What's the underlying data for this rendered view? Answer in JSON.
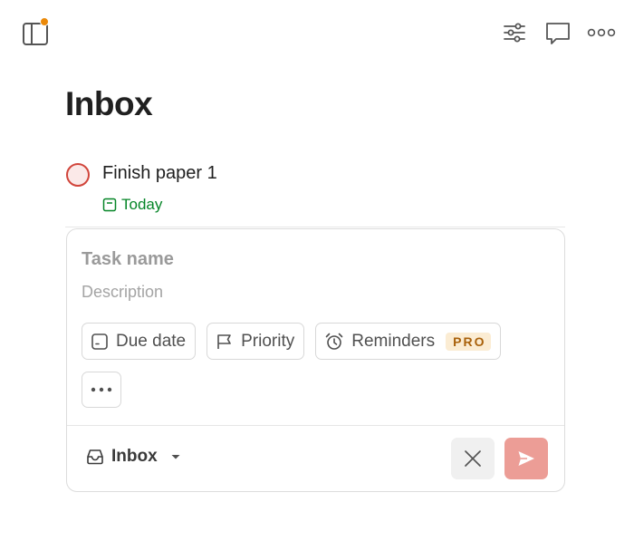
{
  "header": {
    "icons": [
      "sidebar-toggle-icon",
      "view-options-icon",
      "comments-icon",
      "more-horizontal-icon"
    ],
    "notification_dot_color": "#eb8909"
  },
  "page": {
    "title": "Inbox"
  },
  "task": {
    "title": "Finish paper 1",
    "due_label": "Today",
    "priority_color": "#d1453b",
    "due_color": "#058527"
  },
  "editor": {
    "task_name_placeholder": "Task name",
    "description_placeholder": "Description",
    "chips": {
      "due_date": "Due date",
      "priority": "Priority",
      "reminders": "Reminders",
      "reminders_badge": "PRO"
    },
    "project": "Inbox",
    "submit_color": "#ec9d96"
  }
}
